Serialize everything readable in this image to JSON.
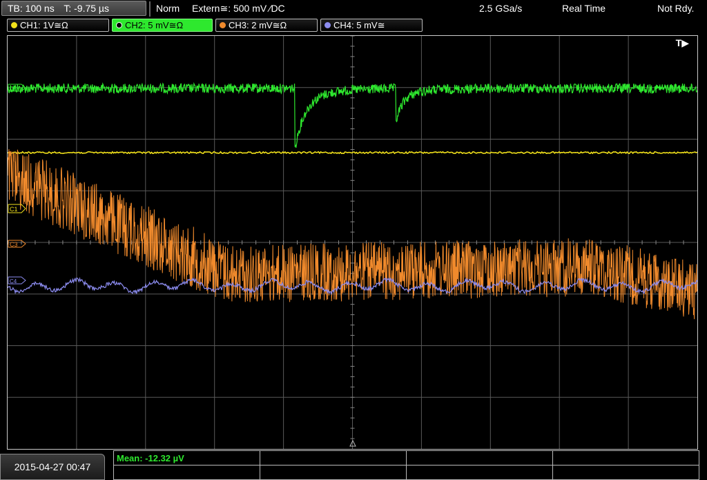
{
  "status": {
    "timebase": "TB: 100 ns",
    "trigger_time": "T: -9.75 µs",
    "mode": "Norm",
    "trigger_source": "Extern≅: 500 mV ⁄DC",
    "sample_rate": "2.5 GSa/s",
    "acq_mode": "Real Time",
    "state": "Not Rdy."
  },
  "channels": [
    {
      "label": "CH1: 1V≅Ω",
      "color": "#f2e21b"
    },
    {
      "label": "CH2: 5 mV≅Ω",
      "color": "#2ee82e",
      "active": true
    },
    {
      "label": "CH3: 2 mV≅Ω",
      "color": "#f08a2c"
    },
    {
      "label": "CH4: 5 mV≅",
      "color": "#8c8cf0"
    }
  ],
  "markers": {
    "trigger": "T▶",
    "c1": "C1",
    "c3": "C3",
    "c2": "C2",
    "c4": "C4"
  },
  "measurement": {
    "mean": "Mean: -12.32 µV"
  },
  "timestamp": "2015-04-27 00:47",
  "colors": {
    "grid": "#5a5a5a",
    "ch1": "#f2e21b",
    "ch2": "#2ee82e",
    "ch3": "#f08a2c",
    "ch4": "#8c8cf0"
  }
}
